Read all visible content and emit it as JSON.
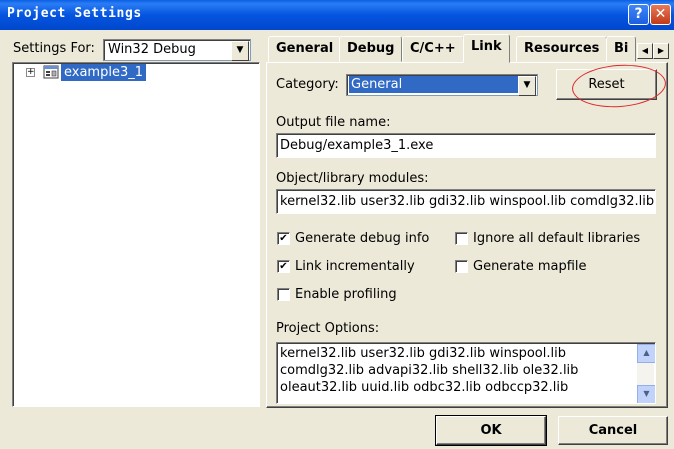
{
  "window": {
    "title": "Project Settings",
    "help_glyph": "?",
    "close_glyph": "✕"
  },
  "settings_for": {
    "label": "Settings For:",
    "value": "Win32 Debug"
  },
  "tree": {
    "expander": "+",
    "project": "example3_1"
  },
  "tabs": [
    "General",
    "Debug",
    "C/C++",
    "Link",
    "Resources",
    "Bi"
  ],
  "tab_scroll": {
    "left": "◀",
    "right": "▶"
  },
  "link": {
    "category_label": "Category:",
    "category_value": "General",
    "reset_label": "Reset",
    "output_label": "Output file name:",
    "output_value": "Debug/example3_1.exe",
    "modules_label": "Object/library modules:",
    "modules_value": "kernel32.lib user32.lib gdi32.lib winspool.lib comdlg32.lib",
    "checks": [
      {
        "label": "Generate debug info",
        "checked": true
      },
      {
        "label": "Ignore all default libraries",
        "checked": false
      },
      {
        "label": "Link incrementally",
        "checked": true
      },
      {
        "label": "Generate mapfile",
        "checked": false
      },
      {
        "label": "Enable profiling",
        "checked": false
      }
    ],
    "options_label": "Project Options:",
    "options_lines": [
      "kernel32.lib user32.lib gdi32.lib winspool.lib",
      "comdlg32.lib advapi32.lib shell32.lib ole32.lib",
      "oleaut32.lib uuid.lib odbc32.lib odbccp32.lib"
    ]
  },
  "buttons": {
    "ok": "OK",
    "cancel": "Cancel"
  },
  "colors": {
    "titlebar": "#0554e0",
    "selection": "#316ac5",
    "dialog_bg": "#ece9d8",
    "annotation": "#e0262a"
  }
}
